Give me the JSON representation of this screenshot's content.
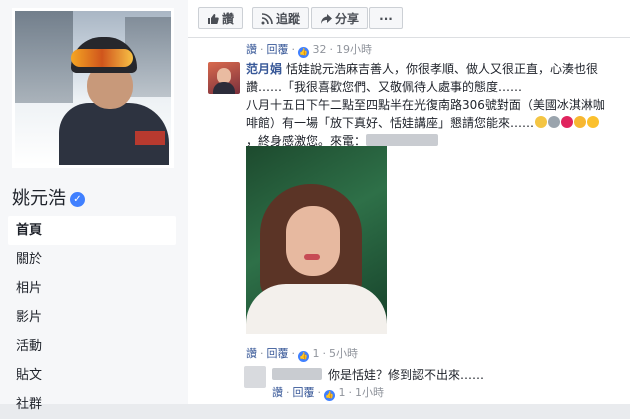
{
  "profile": {
    "name": "姚元浩"
  },
  "nav": {
    "items": [
      {
        "label": "首頁",
        "active": true
      },
      {
        "label": "關於"
      },
      {
        "label": "相片"
      },
      {
        "label": "影片"
      },
      {
        "label": "活動"
      },
      {
        "label": "貼文"
      },
      {
        "label": "社群"
      }
    ]
  },
  "actions": {
    "like_label": "讚",
    "follow_label": "追蹤",
    "share_label": "分享",
    "more_label": "···"
  },
  "comment1_actions": {
    "like": "讚",
    "reply": "回覆",
    "count": "32",
    "time": "19小時"
  },
  "comment2": {
    "name": "范月娟",
    "line1": "恬娃說元浩麻吉善人，你很孝順、做人又很正直，心湊也很",
    "line2": "讚……「我很喜歡您們、又敬佩待人處事的態度……",
    "line3a": "八月十五日下午二點至四點半在光復南路306號對面（美國冰淇淋咖",
    "line3b": "啡館）有一場「放下真好、恬娃講座」懇請您能來……",
    "line4": "，終身感激您。來電："
  },
  "comment2_actions": {
    "like": "讚",
    "reply": "回覆",
    "count": "1",
    "time": "5小時"
  },
  "reply1": {
    "text": "你是恬娃？修到認不出來……"
  },
  "reply1_actions": {
    "like": "讚",
    "reply": "回覆",
    "count": "1",
    "time": "1小時"
  },
  "colors": {
    "link": "#385898",
    "meta": "#90949c",
    "like_blue": "#4080ff"
  }
}
